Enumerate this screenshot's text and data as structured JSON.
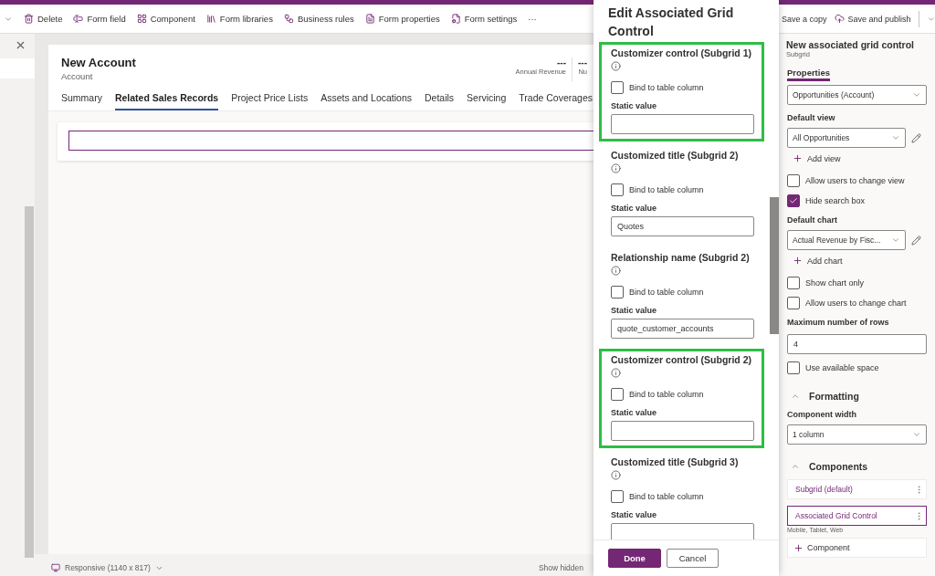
{
  "toolbar": {
    "items": [
      {
        "label": "Delete"
      },
      {
        "label": "Form field"
      },
      {
        "label": "Component"
      },
      {
        "label": "Form libraries"
      },
      {
        "label": "Business rules"
      },
      {
        "label": "Form properties"
      },
      {
        "label": "Form settings"
      }
    ],
    "more": "···"
  },
  "form": {
    "title": "New Account",
    "subtitle": "Account",
    "header_fields": [
      {
        "value": "---",
        "label": "Annual Revenue"
      },
      {
        "value": "---",
        "label": "Nu"
      }
    ],
    "tabs": [
      {
        "label": "Summary",
        "selected": false
      },
      {
        "label": "Related Sales Records",
        "selected": true
      },
      {
        "label": "Project Price Lists",
        "selected": false
      },
      {
        "label": "Assets and Locations",
        "selected": false
      },
      {
        "label": "Details",
        "selected": false
      },
      {
        "label": "Servicing",
        "selected": false
      },
      {
        "label": "Trade Coverages",
        "selected": false
      }
    ]
  },
  "status_bar": {
    "view": "Responsive (1140 x 817)",
    "show_hidden": "Show hidden"
  },
  "dialog": {
    "title": "Edit Associated Grid Control",
    "sections": [
      {
        "label": "Customizer control (Subgrid 1)",
        "highlighted": true,
        "bind_label": "Bind to table column",
        "bind_checked": false,
        "value_label": "Static value"
      },
      {
        "label": "Customized title (Subgrid 2)",
        "highlighted": false,
        "bind_label": "Bind to table column",
        "bind_checked": false,
        "value_label": "Static value",
        "value": "Quotes"
      },
      {
        "label": "Relationship name (Subgrid 2)",
        "highlighted": false,
        "bind_label": "Bind to table column",
        "bind_checked": false,
        "value_label": "Static value",
        "value": "quote_customer_accounts"
      },
      {
        "label": "Customizer control (Subgrid 2)",
        "highlighted": true,
        "bind_label": "Bind to table column",
        "bind_checked": false,
        "value_label": "Static value"
      },
      {
        "label": "Customized title (Subgrid 3)",
        "highlighted": false,
        "bind_label": "Bind to table column",
        "bind_checked": false,
        "value_label": "Static value"
      }
    ],
    "buttons": [
      {
        "label": "Done",
        "kind": "primary"
      },
      {
        "label": "Cancel",
        "kind": "secondary"
      }
    ]
  },
  "command_bar_right": {
    "items": [
      {
        "label": "Save a copy"
      },
      {
        "label": "Save and publish"
      }
    ]
  },
  "properties_pane": {
    "title": "New associated grid control",
    "subtitle": "Subgrid",
    "tabs": [
      {
        "label": "Properties",
        "selected": true
      }
    ],
    "items": [
      {
        "kind": "select",
        "value": "Opportunities (Account)"
      },
      {
        "kind": "label",
        "text": "Default view"
      },
      {
        "kind": "select",
        "value": "All Opportunities",
        "editable": true
      },
      {
        "kind": "add",
        "text": "Add view"
      },
      {
        "kind": "checkbox",
        "text": "Allow users to change view",
        "checked": false
      },
      {
        "kind": "checkbox",
        "text": "Hide search box",
        "checked": true
      },
      {
        "kind": "label",
        "text": "Default chart"
      },
      {
        "kind": "select",
        "value": "Actual Revenue by Fisc...",
        "editable": true
      },
      {
        "kind": "add",
        "text": "Add chart"
      },
      {
        "kind": "checkbox",
        "text": "Show chart only",
        "checked": false
      },
      {
        "kind": "checkbox",
        "text": "Allow users to change chart",
        "checked": false
      },
      {
        "kind": "label",
        "text": "Maximum number of rows"
      },
      {
        "kind": "input",
        "value": "4"
      },
      {
        "kind": "checkbox",
        "text": "Use available space",
        "checked": false
      },
      {
        "kind": "section",
        "text": "Formatting",
        "expanded": true
      },
      {
        "kind": "label",
        "text": "Component width"
      },
      {
        "kind": "select",
        "value": "1 column"
      },
      {
        "kind": "section",
        "text": "Components",
        "expanded": true
      },
      {
        "kind": "component",
        "text": "Subgrid (default)",
        "selected": false
      },
      {
        "kind": "component",
        "text": "Associated Grid Control",
        "selected": true,
        "note": "Mobile, Tablet, Web"
      },
      {
        "kind": "add-component",
        "text": "Component"
      }
    ]
  }
}
